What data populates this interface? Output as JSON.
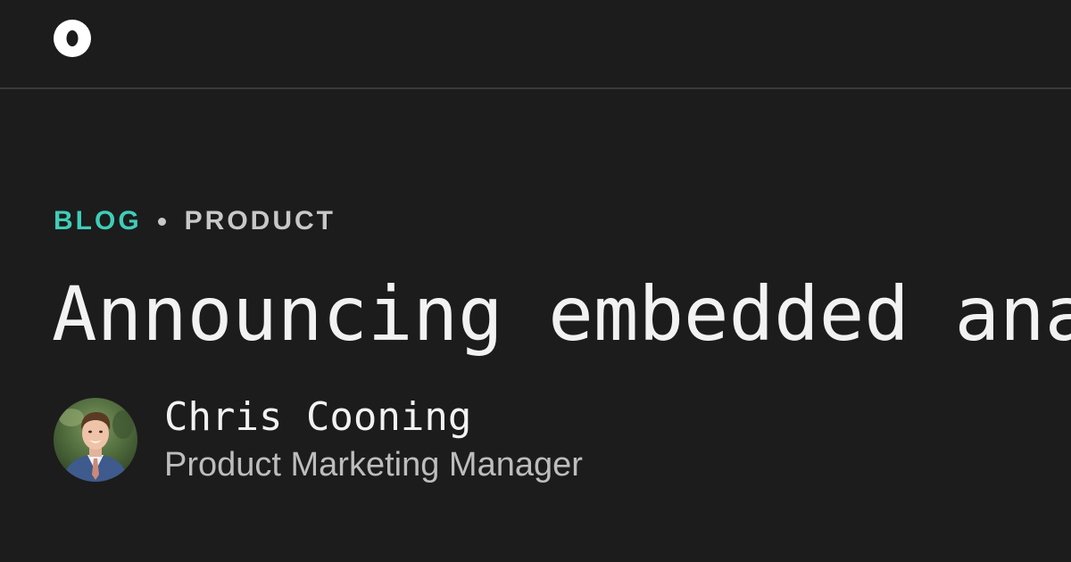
{
  "brand": {
    "logo_icon": "ring-logo-icon",
    "color": "#ffffff"
  },
  "post": {
    "category": "BLOG",
    "subcategory": "PRODUCT",
    "title": "Announcing embedded analytics",
    "accent_color": "#3fcdb8"
  },
  "author": {
    "name": "Chris Cooning",
    "role": "Product Marketing Manager",
    "avatar_icon": "author-portrait"
  }
}
